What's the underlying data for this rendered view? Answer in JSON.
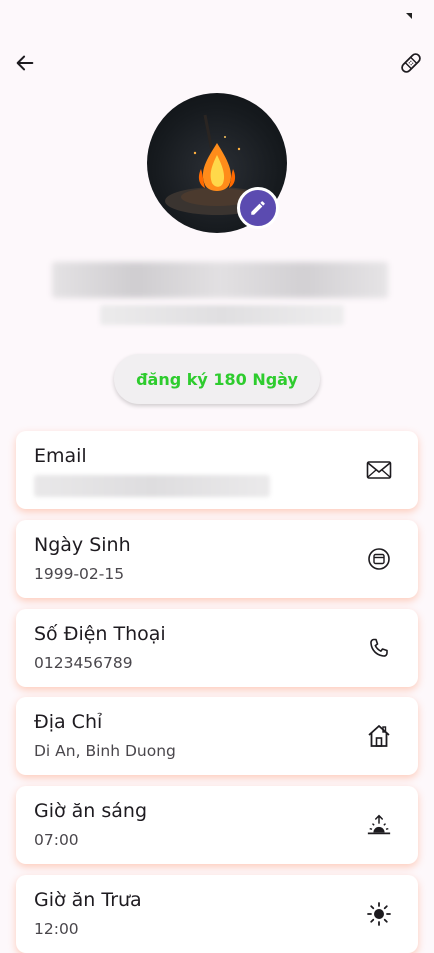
{
  "icons": {
    "back": "arrow-left-icon",
    "tool": "bandage-icon",
    "edit": "pencil-icon"
  },
  "profile": {
    "registration_label": "đăng ký 180 Ngày"
  },
  "colors": {
    "background": "#fdf8fb",
    "accent": "#5b4bb0",
    "registration_text": "#2ecc2e",
    "card_shadow": "#ff966e"
  },
  "cards": [
    {
      "label": "Email",
      "value": "",
      "icon": "mail-icon"
    },
    {
      "label": "Ngày Sinh",
      "value": "1999-02-15",
      "icon": "calendar-icon"
    },
    {
      "label": "Số Điện Thoại",
      "value": "0123456789",
      "icon": "phone-icon"
    },
    {
      "label": "Địa Chỉ",
      "value": "Di An, Binh Duong",
      "icon": "home-icon"
    },
    {
      "label": "Giờ ăn sáng",
      "value": "07:00",
      "icon": "sunrise-icon"
    },
    {
      "label": "Giờ ăn Trưa",
      "value": "12:00",
      "icon": "sun-icon"
    }
  ]
}
